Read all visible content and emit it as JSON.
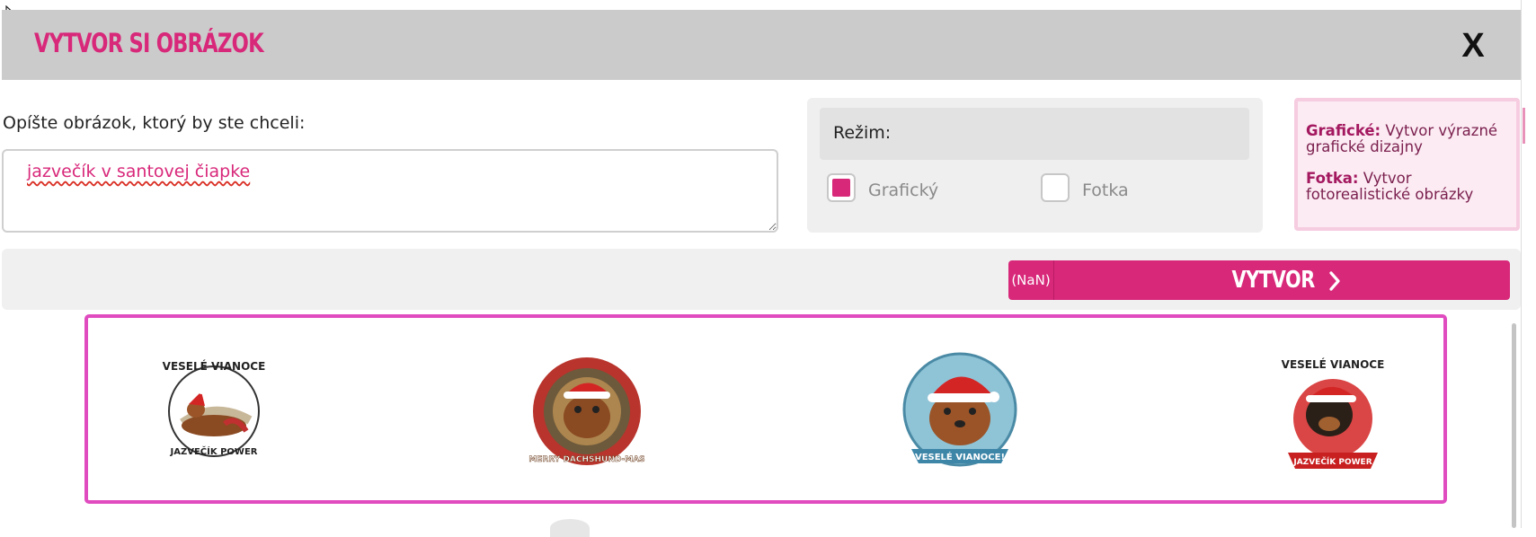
{
  "modal": {
    "title": "VYTVOR SI OBRÁZOK",
    "close_label": "X"
  },
  "prompt": {
    "label": "Opíšte obrázok, ktorý by ste chceli:",
    "value": "jazvečík v santovej čiapke"
  },
  "mode": {
    "label": "Režim:",
    "options": [
      {
        "label": "Grafický",
        "checked": true
      },
      {
        "label": "Fotka",
        "checked": false
      }
    ]
  },
  "info": {
    "graphic_term": "Grafické:",
    "graphic_desc": "Vytvor výrazné grafické dizajny",
    "photo_term": "Fotka:",
    "photo_desc": "Vytvor fotorealistické obrázky"
  },
  "create_button": {
    "counter": "(NaN)",
    "label": "VYTVOR"
  },
  "gallery": {
    "items": [
      {
        "top_text": "VESELÉ VIANOCE",
        "bottom_text": "JAZVEČÍK POWER",
        "icon": "dachshund-santa-icon"
      },
      {
        "top_text": "",
        "bottom_text": "MERRY DACHSHUND-MAS",
        "icon": "dachshund-santa-icon"
      },
      {
        "top_text": "",
        "bottom_text": "VESELÉ VIANOCE!",
        "icon": "dachshund-santa-icon"
      },
      {
        "top_text": "VESELÉ VIANOCE",
        "bottom_text": "JAZVEČÍK POWER",
        "icon": "dachshund-santa-icon"
      }
    ]
  },
  "colors": {
    "accent": "#d8287a",
    "gallery_border": "#e04bbf",
    "header_bg": "#cbcbcb"
  }
}
